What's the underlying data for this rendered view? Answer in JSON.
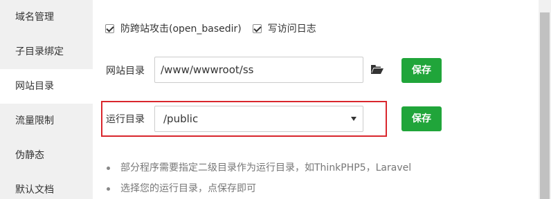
{
  "sidebar": {
    "items": [
      {
        "label": "域名管理"
      },
      {
        "label": "子目录绑定"
      },
      {
        "label": "网站目录"
      },
      {
        "label": "流量限制"
      },
      {
        "label": "伪静态"
      },
      {
        "label": "默认文档"
      }
    ],
    "active": "网站目录"
  },
  "options": {
    "open_basedir_label": "防跨站攻击(open_basedir)",
    "open_basedir_checked": true,
    "access_log_label": "写访问日志",
    "access_log_checked": true
  },
  "site_dir": {
    "label": "网站目录",
    "value": "/www/wwwroot/ss",
    "folder_icon": "folder-open-icon",
    "save_label": "保存"
  },
  "run_dir": {
    "label": "运行目录",
    "selected": "/public",
    "save_label": "保存"
  },
  "notes": [
    "部分程序需要指定二级目录作为运行目录，如ThinkPHP5，Laravel",
    "选择您的运行目录，点保存即可"
  ],
  "colors": {
    "accent": "#20a53a",
    "highlight_border": "#d9262c",
    "sidebar_bg": "#f0f0f0"
  }
}
